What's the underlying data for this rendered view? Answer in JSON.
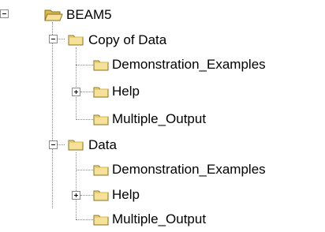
{
  "tree": {
    "root": {
      "label": "BEAM5",
      "state": "expanded",
      "children": [
        {
          "label": "Copy of Data",
          "state": "expanded",
          "children": [
            {
              "label": "Demonstration_Examples",
              "state": "leaf"
            },
            {
              "label": "Help",
              "state": "collapsed"
            },
            {
              "label": "Multiple_Output",
              "state": "leaf"
            }
          ]
        },
        {
          "label": "Data",
          "state": "expanded",
          "children": [
            {
              "label": "Demonstration_Examples",
              "state": "leaf"
            },
            {
              "label": "Help",
              "state": "collapsed"
            },
            {
              "label": "Multiple_Output",
              "state": "leaf"
            }
          ]
        }
      ]
    }
  },
  "icons": {
    "expanded": "minus-expander-icon",
    "collapsed": "plus-expander-icon",
    "folder_closed": "folder-icon",
    "folder_open": "open-folder-icon"
  },
  "colors": {
    "folder_fill": "#f5e197",
    "folder_shade": "#d9b94a",
    "folder_outline": "#8a7020",
    "tree_lines": "#8a8a8a",
    "text": "#000000",
    "background": "#ffffff"
  }
}
